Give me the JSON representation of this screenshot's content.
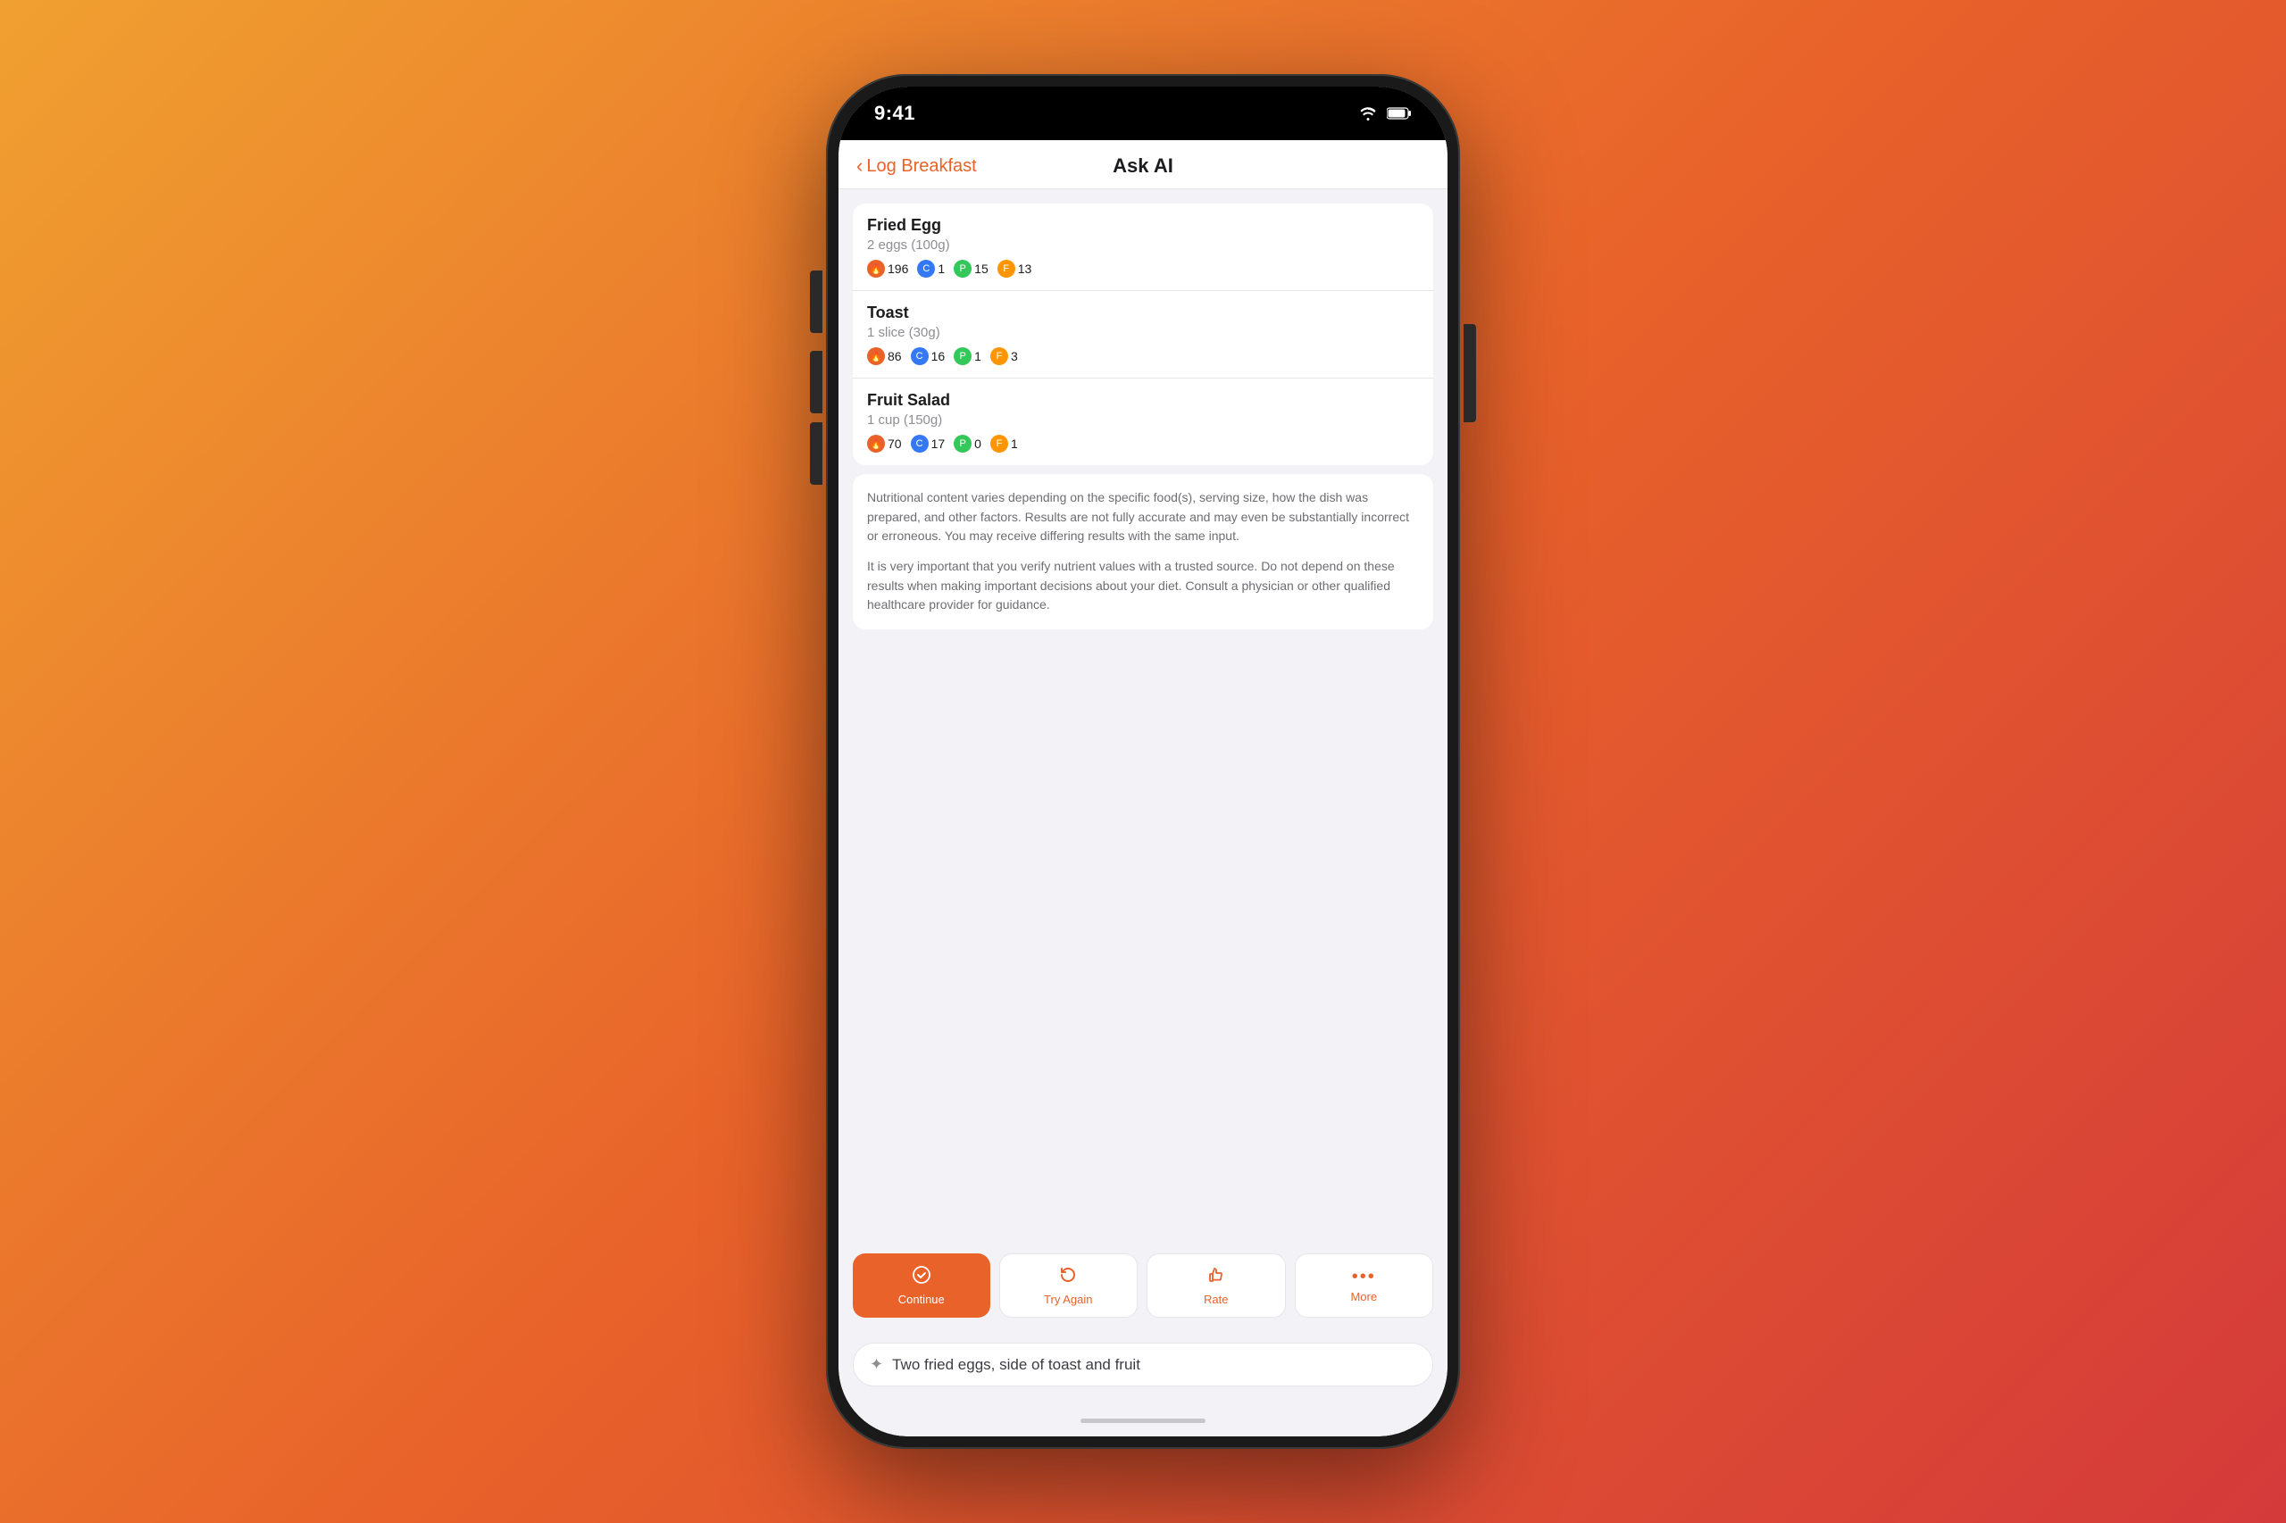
{
  "status_bar": {
    "time": "9:41",
    "wifi_icon": "wifi",
    "battery_icon": "battery"
  },
  "nav": {
    "back_label": "Log Breakfast",
    "title": "Ask AI"
  },
  "food_items": [
    {
      "name": "Fried Egg",
      "serving": "2 eggs (100g)",
      "nutrients": [
        {
          "type": "cal",
          "icon": "🔥",
          "value": "196"
        },
        {
          "type": "carb",
          "icon": "C",
          "value": "1"
        },
        {
          "type": "protein",
          "icon": "P",
          "value": "15"
        },
        {
          "type": "fat",
          "icon": "F",
          "value": "13"
        }
      ]
    },
    {
      "name": "Toast",
      "serving": "1 slice (30g)",
      "nutrients": [
        {
          "type": "cal",
          "icon": "🔥",
          "value": "86"
        },
        {
          "type": "carb",
          "icon": "C",
          "value": "16"
        },
        {
          "type": "protein",
          "icon": "P",
          "value": "1"
        },
        {
          "type": "fat",
          "icon": "F",
          "value": "3"
        }
      ]
    },
    {
      "name": "Fruit Salad",
      "serving": "1 cup (150g)",
      "nutrients": [
        {
          "type": "cal",
          "icon": "🔥",
          "value": "70"
        },
        {
          "type": "carb",
          "icon": "C",
          "value": "17"
        },
        {
          "type": "protein",
          "icon": "P",
          "value": "0"
        },
        {
          "type": "fat",
          "icon": "F",
          "value": "1"
        }
      ]
    }
  ],
  "disclaimer": {
    "para1": "Nutritional content varies depending on the specific food(s), serving size, how the dish was prepared, and other factors. Results are not fully accurate and may even be substantially incorrect or erroneous. You may receive differing results with the same input.",
    "para2": "It is very important that you verify nutrient values with a trusted source. Do not depend on these results when making important decisions about your diet. Consult a physician or other qualified healthcare provider for guidance."
  },
  "action_buttons": [
    {
      "id": "continue",
      "label": "Continue",
      "type": "primary",
      "icon": "✓"
    },
    {
      "id": "try_again",
      "label": "Try Again",
      "type": "secondary",
      "icon": "↻"
    },
    {
      "id": "rate",
      "label": "Rate",
      "type": "secondary",
      "icon": "👍"
    },
    {
      "id": "more",
      "label": "More",
      "type": "secondary",
      "icon": "···"
    }
  ],
  "input": {
    "value": "Two fried eggs, side of toast and fruit",
    "placeholder": "Two fried eggs, side of toast and fruit"
  },
  "icons": {
    "cal_symbol": "🔥",
    "carb_symbol": "C",
    "protein_symbol": "P",
    "fat_symbol": "F"
  }
}
